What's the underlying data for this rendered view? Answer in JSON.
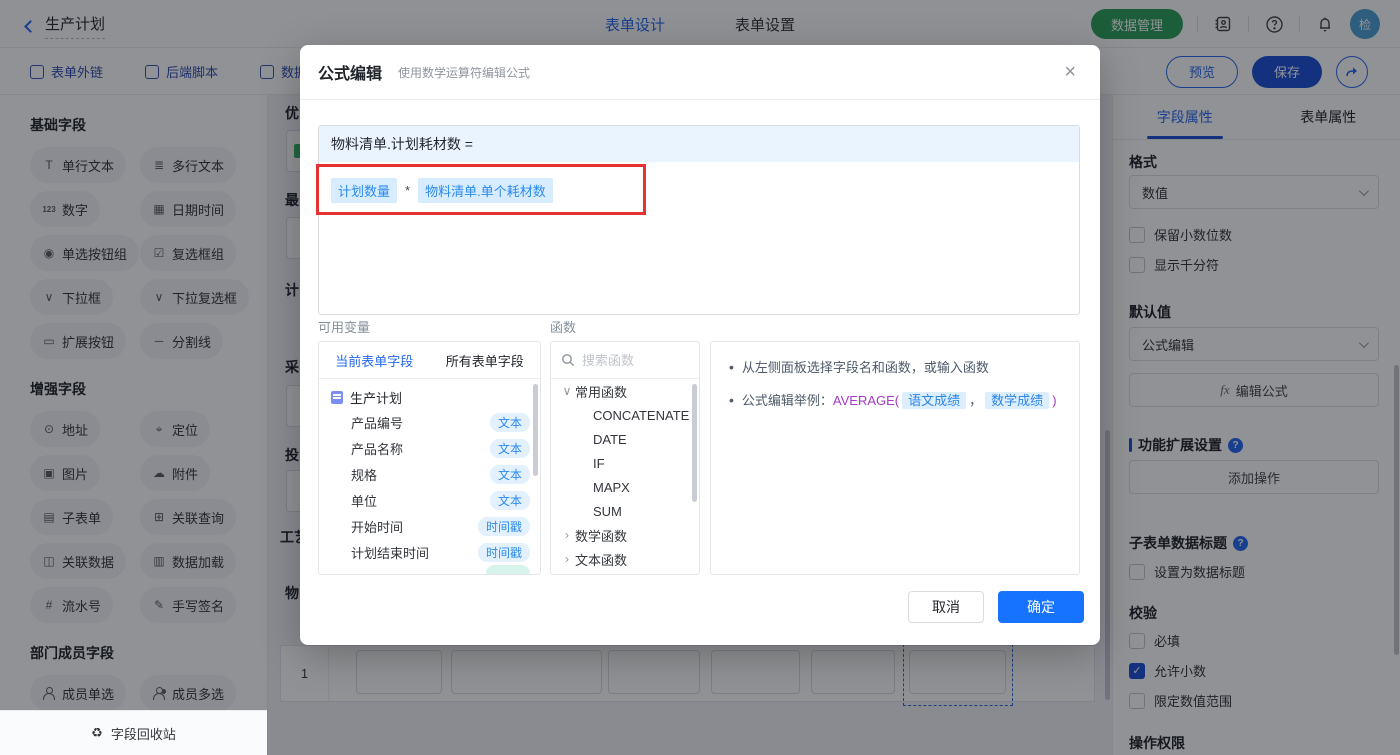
{
  "colors": {
    "primary": "#2468f2",
    "save_blue": "#1b4fd8",
    "green": "#2aa05a",
    "annotation_red": "#e53232",
    "token_blue": "#2a8af0",
    "token_bg": "#d8ecff",
    "formula_header_bg": "#e9f4ff"
  },
  "topbar": {
    "back_label": "生产计划",
    "nav": [
      {
        "label": "表单设计",
        "active": true
      },
      {
        "label": "表单设置",
        "active": false
      }
    ],
    "data_manage_label": "数据管理",
    "avatar_text": "检"
  },
  "subbar": {
    "items": [
      {
        "label": "表单外链",
        "icon_name": "link-icon"
      },
      {
        "label": "后端脚本",
        "icon_name": "script-icon"
      },
      {
        "label": "数据权",
        "icon_name": "data-permission-icon"
      }
    ],
    "preview_label": "预览",
    "save_label": "保存"
  },
  "left_sidebar": {
    "sections": [
      {
        "title": "基础字段",
        "items": [
          {
            "label": "单行文本",
            "glyph": "T",
            "icon_name": "single-line-text-icon"
          },
          {
            "label": "多行文本",
            "glyph": "≣",
            "icon_name": "multi-line-text-icon"
          },
          {
            "label": "数字",
            "glyph": "123",
            "num": true,
            "icon_name": "number-icon"
          },
          {
            "label": "日期时间",
            "glyph": "▦",
            "icon_name": "datetime-icon"
          },
          {
            "label": "单选按钮组",
            "glyph": "◉",
            "icon_name": "radio-group-icon"
          },
          {
            "label": "复选框组",
            "glyph": "☑",
            "icon_name": "checkbox-group-icon"
          },
          {
            "label": "下拉框",
            "glyph": "∨",
            "icon_name": "dropdown-icon"
          },
          {
            "label": "下拉复选框",
            "glyph": "∨",
            "icon_name": "dropdown-multi-icon"
          },
          {
            "label": "扩展按钮",
            "glyph": "▭",
            "icon_name": "extend-button-icon"
          },
          {
            "label": "分割线",
            "glyph": "─",
            "icon_name": "divider-icon"
          }
        ]
      },
      {
        "title": "增强字段",
        "items": [
          {
            "label": "地址",
            "glyph": "⊙",
            "icon_name": "address-icon"
          },
          {
            "label": "定位",
            "glyph": "⌖",
            "icon_name": "location-icon"
          },
          {
            "label": "图片",
            "glyph": "▣",
            "icon_name": "image-icon"
          },
          {
            "label": "附件",
            "glyph": "☁",
            "icon_name": "attachment-icon"
          },
          {
            "label": "子表单",
            "glyph": "▤",
            "icon_name": "subform-icon"
          },
          {
            "label": "关联查询",
            "glyph": "⊞",
            "icon_name": "linked-query-icon"
          },
          {
            "label": "关联数据",
            "glyph": "◫",
            "icon_name": "linked-data-icon"
          },
          {
            "label": "数据加载",
            "glyph": "▥",
            "icon_name": "data-load-icon"
          },
          {
            "label": "流水号",
            "glyph": "#",
            "icon_name": "serial-number-icon"
          },
          {
            "label": "手写签名",
            "glyph": "✎",
            "icon_name": "signature-icon"
          }
        ]
      },
      {
        "title": "部门成员字段",
        "items": [
          {
            "label": "成员单选",
            "glyph": "",
            "shape": "person",
            "icon_name": "member-single-icon"
          },
          {
            "label": "成员多选",
            "glyph": "",
            "shape": "person-multi",
            "icon_name": "member-multi-icon"
          }
        ]
      }
    ],
    "recycle_label": "字段回收站",
    "recycle_glyph": "♻"
  },
  "canvas": {
    "fragments": [
      {
        "text": "优",
        "pos": "0"
      },
      {
        "text": "最",
        "pos": "1"
      },
      {
        "text": "计",
        "pos": "2"
      },
      {
        "text": "采",
        "pos": "3"
      },
      {
        "text": "投",
        "pos": "4"
      },
      {
        "text": "工艺",
        "pos": "5"
      },
      {
        "text": "物",
        "pos": "6"
      }
    ],
    "table": {
      "row_number": "1"
    }
  },
  "right_panel": {
    "tabs": [
      {
        "label": "字段属性",
        "active": true
      },
      {
        "label": "表单属性",
        "active": false
      }
    ],
    "format_label": "格式",
    "format_value": "数值",
    "keep_decimal_label": "保留小数位数",
    "thousand_sep_label": "显示千分符",
    "default_label": "默认值",
    "default_value": "公式编辑",
    "edit_formula_label": "编辑公式",
    "fx_glyph": "fx",
    "ext_section_label": "功能扩展设置",
    "add_action_label": "添加操作",
    "subform_title_label": "子表单数据标题",
    "set_data_title_label": "设置为数据标题",
    "validation_label": "校验",
    "required_label": "必填",
    "allow_decimal_label": "允许小数",
    "allow_decimal_checked": "✓",
    "limit_range_label": "限定数值范围",
    "permission_label": "操作权限"
  },
  "modal": {
    "title": "公式编辑",
    "subtitle": "使用数学运算符编辑公式",
    "close_glyph": "×",
    "formula_target": "物料清单.计划耗材数 =",
    "token_left": "计划数量",
    "operator": "*",
    "token_right": "物料清单.单个耗材数",
    "vars_label": "可用变量",
    "vars_tabs": [
      {
        "label": "当前表单字段",
        "active": true
      },
      {
        "label": "所有表单字段",
        "active": false
      }
    ],
    "tree_root": "生产计划",
    "fields": [
      {
        "name": "产品编号",
        "type": "文本"
      },
      {
        "name": "产品名称",
        "type": "文本"
      },
      {
        "name": "规格",
        "type": "文本"
      },
      {
        "name": "单位",
        "type": "文本"
      },
      {
        "name": "开始时间",
        "type": "时间戳"
      },
      {
        "name": "计划结束时间",
        "type": "时间戳"
      }
    ],
    "func_label": "函数",
    "search_placeholder": "搜索函数",
    "func_rows": [
      {
        "text": "常用函数",
        "kind": "group",
        "chev": "∨"
      },
      {
        "text": "CONCATENATE",
        "kind": "item",
        "chev": ""
      },
      {
        "text": "DATE",
        "kind": "item",
        "chev": ""
      },
      {
        "text": "IF",
        "kind": "item",
        "chev": ""
      },
      {
        "text": "MAPX",
        "kind": "item",
        "chev": ""
      },
      {
        "text": "SUM",
        "kind": "item",
        "chev": ""
      },
      {
        "text": "数学函数",
        "kind": "group",
        "chev": "›"
      },
      {
        "text": "文本函数",
        "kind": "group",
        "chev": "›"
      }
    ],
    "help_line1": "从左侧面板选择字段名和函数，或输入函数",
    "help_line2": {
      "prefix": "公式编辑举例：",
      "func_open": "AVERAGE(",
      "chip1": "语文成绩",
      "comma": "，",
      "chip2": "数学成绩",
      "func_close": ")"
    },
    "cancel_label": "取消",
    "ok_label": "确定"
  }
}
